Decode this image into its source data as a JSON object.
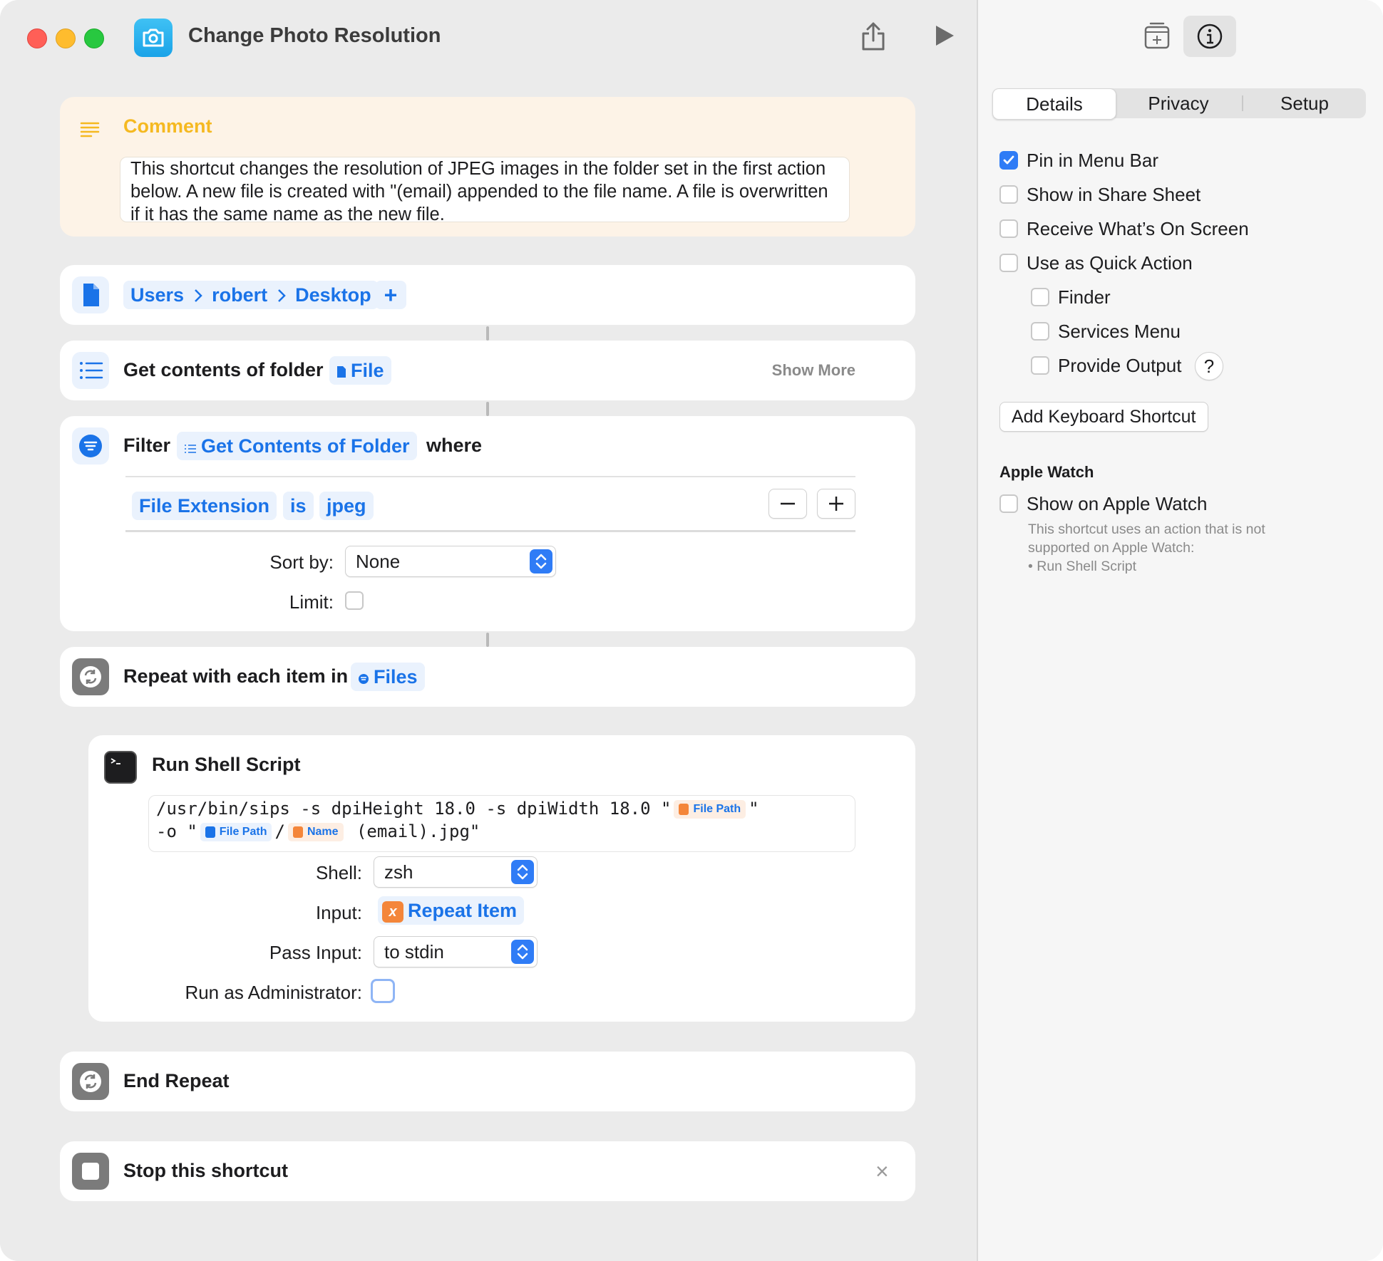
{
  "window": {
    "title": "Change Photo Resolution"
  },
  "comment": {
    "title": "Comment",
    "text": "This shortcut changes the resolution of JPEG images in the folder set in the first action below. A new file is created with \"(email) appended to the file name. A file is overwritten if it has the same name as the new file."
  },
  "folder_action": {
    "path": [
      "Users",
      "robert",
      "Desktop"
    ],
    "add_label": "+"
  },
  "get_contents": {
    "title": "Get contents of folder",
    "variable": "File",
    "show_more": "Show More"
  },
  "filter": {
    "title": "Filter",
    "variable": "Get Contents of Folder",
    "where": "where",
    "condition": {
      "property": "File Extension",
      "operator": "is",
      "value": "jpeg"
    },
    "sort_label": "Sort by:",
    "sort_value": "None",
    "limit_label": "Limit:",
    "limit_checked": false
  },
  "repeat": {
    "title": "Repeat with each item in",
    "variable": "Files"
  },
  "shell": {
    "title": "Run Shell Script",
    "script_line1": "/usr/bin/sips -s dpiHeight 18.0 -s dpiWidth 18.0 \"",
    "token_file_path_1": "File Path",
    "script_quote_1": "\"",
    "script_line2_start": "-o \"",
    "token_file_path_2": "File Path",
    "script_slash": "/",
    "token_name": "Name",
    "script_line2_end": " (email).jpg\"",
    "shell_label": "Shell:",
    "shell_value": "zsh",
    "input_label": "Input:",
    "input_value": "Repeat Item",
    "pass_input_label": "Pass Input:",
    "pass_input_value": "to stdin",
    "admin_label": "Run as Administrator:",
    "admin_checked": false
  },
  "end_repeat": {
    "title": "End Repeat"
  },
  "stop": {
    "title": "Stop this shortcut",
    "close": "×"
  },
  "sidebar": {
    "tabs": [
      "Details",
      "Privacy",
      "Setup"
    ],
    "selected_tab": "Details",
    "options": [
      {
        "label": "Pin in Menu Bar",
        "checked": true
      },
      {
        "label": "Show in Share Sheet",
        "checked": false
      },
      {
        "label": "Receive What’s On Screen",
        "checked": false
      },
      {
        "label": "Use as Quick Action",
        "checked": false
      }
    ],
    "quick_action_options": [
      {
        "label": "Finder",
        "checked": false
      },
      {
        "label": "Services Menu",
        "checked": false
      },
      {
        "label": "Provide Output",
        "checked": false
      }
    ],
    "help_label": "?",
    "keyboard_shortcut_button": "Add Keyboard Shortcut",
    "apple_watch_heading": "Apple Watch",
    "apple_watch_option": {
      "label": "Show on Apple Watch",
      "checked": false
    },
    "apple_watch_note_1": "This shortcut uses an action that is not",
    "apple_watch_note_2": "supported on Apple Watch:",
    "apple_watch_note_3": "• Run Shell Script"
  },
  "colors": {
    "accent": "#2f7cf6",
    "token_text": "#1a73e8",
    "comment_bg": "#fdf3e7",
    "comment_title": "#f5b921",
    "variable_orange": "#f4863a"
  },
  "icons": [
    "camera-icon",
    "share-icon",
    "play-icon",
    "add-to-dock-icon",
    "info-icon",
    "comment-lines-icon",
    "document-icon",
    "list-icon",
    "filter-icon",
    "repeat-icon",
    "terminal-icon",
    "stop-icon",
    "close-icon",
    "chevron-right-icon",
    "up-down-arrows-icon",
    "checkmark-icon"
  ]
}
